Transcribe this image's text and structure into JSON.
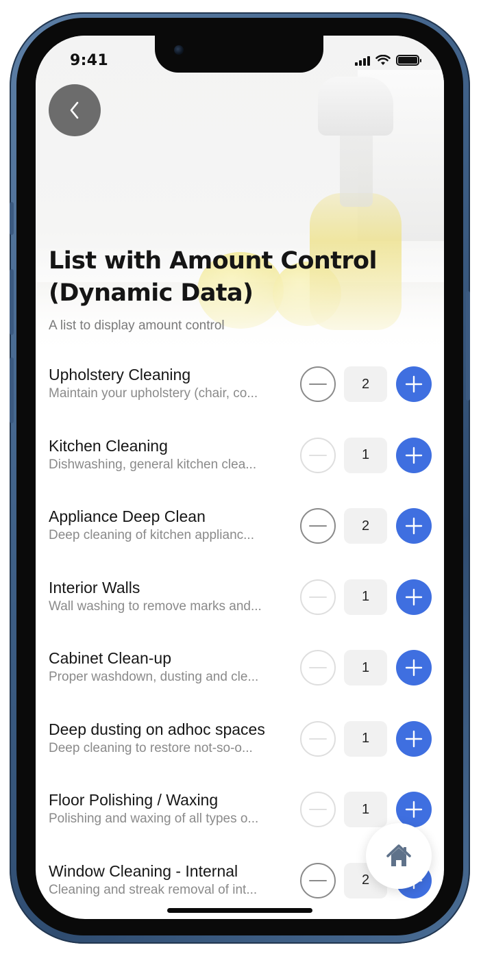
{
  "status_bar": {
    "time": "9:41"
  },
  "header": {
    "title": "List with Amount Control (Dynamic Data)",
    "subtitle": "A list to display amount control"
  },
  "colors": {
    "accent": "#3f6fe0",
    "back_button_bg": "#646464",
    "quantity_bg": "#f1f1f1",
    "title_text": "#151515",
    "muted_text": "#8a8a8a"
  },
  "icons": {
    "back": "chevron-left-icon",
    "decrement": "minus-icon",
    "increment": "plus-icon",
    "home": "home-icon"
  },
  "items": [
    {
      "title": "Upholstery Cleaning",
      "description": "Maintain your upholstery (chair, co...",
      "quantity": "2",
      "minus_enabled": true
    },
    {
      "title": "Kitchen Cleaning",
      "description": "Dishwashing, general kitchen clea...",
      "quantity": "1",
      "minus_enabled": false
    },
    {
      "title": "Appliance Deep Clean",
      "description": "Deep cleaning of kitchen applianc...",
      "quantity": "2",
      "minus_enabled": true
    },
    {
      "title": "Interior Walls",
      "description": "Wall washing to remove marks and...",
      "quantity": "1",
      "minus_enabled": false
    },
    {
      "title": "Cabinet Clean-up",
      "description": "Proper washdown, dusting and cle...",
      "quantity": "1",
      "minus_enabled": false
    },
    {
      "title": "Deep dusting on adhoc spaces",
      "description": "Deep cleaning to restore not-so-o...",
      "quantity": "1",
      "minus_enabled": false
    },
    {
      "title": "Floor Polishing / Waxing",
      "description": "Polishing and waxing of all types o...",
      "quantity": "1",
      "minus_enabled": false
    },
    {
      "title": "Window Cleaning - Internal",
      "description": "Cleaning and streak removal of int...",
      "quantity": "2",
      "minus_enabled": true
    }
  ]
}
